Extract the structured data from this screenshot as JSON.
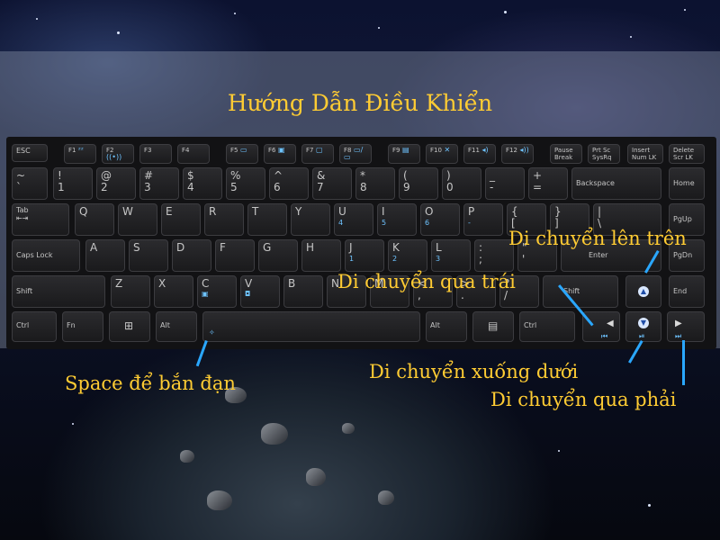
{
  "title": "Hướng Dẫn Điều Khiển",
  "annotations": {
    "up": "Di chuyển lên trên",
    "left": "Di chuyển qua trái",
    "down": "Di chuyển xuống dưới",
    "right": "Di chuyển qua phải",
    "space": "Space để bắn đạn"
  },
  "colors": {
    "annotation_text": "#ffcc33",
    "annotation_line": "#2aa7ff",
    "fn_icon": "#6ec3ff"
  },
  "keys": {
    "esc": "ESC",
    "f1": "F1",
    "f2": "F2",
    "f3": "F3",
    "f4": "F4",
    "f5": "F5",
    "f6": "F6",
    "f7": "F7",
    "f8": "F8",
    "f9": "F9",
    "f10": "F10",
    "f11": "F11",
    "f12": "F12",
    "pause_top": "Pause",
    "pause_bottom": "Break",
    "prtsc_top": "Prt Sc",
    "prtsc_bottom": "SysRq",
    "insert_top": "Insert",
    "insert_bottom": "Num LK",
    "delete_top": "Delete",
    "delete_bottom": "Scr LK",
    "tilde_top": "~",
    "tilde_bottom": "`",
    "n1_top": "!",
    "n1_bottom": "1",
    "n2_top": "@",
    "n2_bottom": "2",
    "n3_top": "#",
    "n3_bottom": "3",
    "n4_top": "$",
    "n4_bottom": "4",
    "n5_top": "%",
    "n5_bottom": "5",
    "n6_top": "^",
    "n6_bottom": "6",
    "n7_top": "&",
    "n7_bottom": "7",
    "n7_sub": "7",
    "n8_top": "*",
    "n8_bottom": "8",
    "n8_sub": "8",
    "n9_top": "(",
    "n9_bottom": "9",
    "n9_sub": "9",
    "n0_top": ")",
    "n0_bottom": "0",
    "n0_sub": "*",
    "minus_top": "_",
    "minus_bottom": "-",
    "plus_top": "+",
    "plus_bottom": "=",
    "backspace": "Backspace",
    "home": "Home",
    "tab": "Tab",
    "q": "Q",
    "w": "W",
    "e": "E",
    "r": "R",
    "t": "T",
    "y": "Y",
    "u": "U",
    "u_sub": "4",
    "i": "I",
    "i_sub": "5",
    "o": "O",
    "o_sub": "6",
    "p": "P",
    "p_sub": "-",
    "lbrace_top": "{",
    "lbrace_bottom": "[",
    "rbrace_top": "}",
    "rbrace_bottom": "]",
    "pipe_top": "|",
    "pipe_bottom": "\\",
    "pgup": "PgUp",
    "capslock": "Caps Lock",
    "a": "A",
    "s": "S",
    "d": "D",
    "f": "F",
    "g": "G",
    "h": "H",
    "j": "J",
    "j_sub": "1",
    "k": "K",
    "k_sub": "2",
    "l": "L",
    "l_sub": "3",
    "colon_top": ":",
    "colon_bottom": ";",
    "colon_sub": "+",
    "quote_top": "\"",
    "quote_bottom": "'",
    "enter": "Enter",
    "pgdn": "PgDn",
    "shift": "Shift",
    "z": "Z",
    "x": "X",
    "c": "C",
    "v": "V",
    "b": "B",
    "n": "N",
    "m": "M",
    "m_sub": "0",
    "comma_top": "<",
    "comma_bottom": ",",
    "period_top": ">",
    "period_bottom": ".",
    "period_sub": ".",
    "slash_top": "?",
    "slash_bottom": "/",
    "slash_sub": "/",
    "rshift": "Shift",
    "end": "End",
    "ctrl": "Ctrl",
    "fn": "Fn",
    "alt": "Alt",
    "ralt": "Alt",
    "rctrl": "Ctrl"
  }
}
